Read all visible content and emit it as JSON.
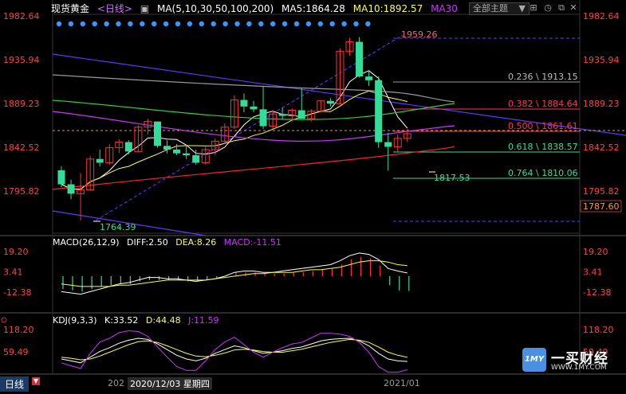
{
  "header": {
    "symbol": "现货黄金",
    "period_select": "<日线>",
    "ma_label": "MA(5,10,30,50,100,200)",
    "ma5": "MA5:1864.28",
    "ma10": "MA10:1892.57",
    "ma30": "MA30"
  },
  "toolbar": {
    "theme_select": "全部主题",
    "icons": [
      "grid-icon",
      "clock-icon",
      "restore-icon",
      "close-icon"
    ]
  },
  "colors": {
    "up": "#ff3030",
    "down": "#33dd99",
    "ma5": "#ffffff",
    "ma10": "#ffff33",
    "ma30": "#cc33ff",
    "ma50": "#33cc33",
    "ma100": "#999999",
    "ma200": "#ff2020",
    "trend": "#6633ff",
    "fib": "#ff3060"
  },
  "price_axis": {
    "left_ticks": [
      "1982.64",
      "1935.94",
      "1889.23",
      "1842.52",
      "1795.82"
    ],
    "right_ticks": [
      "1982.64",
      "1935.94",
      "1889.23",
      "1842.52",
      "1795.82"
    ],
    "current_price": "1787.60"
  },
  "annotations": {
    "high": "1959.26",
    "low1": "1764.39",
    "low2": "1817.53"
  },
  "fib_levels": [
    {
      "label": "0.236 \\ 1913.15",
      "ratio": 0.236,
      "price": 1913.15
    },
    {
      "label": "0.382 \\ 1884.64",
      "ratio": 0.382,
      "price": 1884.64
    },
    {
      "label": "0.500 \\ 1861.61",
      "ratio": 0.5,
      "price": 1861.61
    },
    {
      "label": "0.618 \\ 1838.57",
      "ratio": 0.618,
      "price": 1838.57
    },
    {
      "label": "0.764 \\ 1810.06",
      "ratio": 0.764,
      "price": 1810.06
    }
  ],
  "macd": {
    "label": "MACD(26,12,9)",
    "diff": "DIFF:2.50",
    "dea": "DEA:8.26",
    "macd": "MACD:-11.51",
    "ticks": [
      "19.20",
      "3.41",
      "-12.38"
    ]
  },
  "kdj": {
    "label": "KDJ(9,3,3)",
    "k": "K:33.52",
    "d": "D:44.48",
    "j": "J:11.59",
    "ticks": [
      "118.20",
      "59.49"
    ]
  },
  "bottom": {
    "period": "日线",
    "year_left": "202",
    "date": "2020/12/03 星期四",
    "month": "2021/01"
  },
  "watermark": {
    "logo_text": "1MY",
    "brand": "一买财经",
    "url": "WWW.1MY.COM"
  },
  "chart_data": {
    "type": "candlestick",
    "title": "现货黄金 <日线>",
    "ylim": [
      1764,
      1982.64
    ],
    "ohlc": [
      [
        1818,
        1822,
        1800,
        1803
      ],
      [
        1803,
        1808,
        1787,
        1793
      ],
      [
        1793,
        1815,
        1764.39,
        1797
      ],
      [
        1797,
        1833,
        1796,
        1830
      ],
      [
        1830,
        1840,
        1822,
        1826
      ],
      [
        1826,
        1846,
        1824,
        1842
      ],
      [
        1842,
        1851,
        1836,
        1848
      ],
      [
        1848,
        1850,
        1835,
        1838
      ],
      [
        1838,
        1866,
        1837,
        1864
      ],
      [
        1864,
        1873,
        1856,
        1870
      ],
      [
        1870,
        1870,
        1842,
        1844
      ],
      [
        1844,
        1850,
        1836,
        1840
      ],
      [
        1840,
        1846,
        1834,
        1836
      ],
      [
        1836,
        1845,
        1830,
        1834
      ],
      [
        1834,
        1840,
        1824,
        1826
      ],
      [
        1826,
        1844,
        1824,
        1840
      ],
      [
        1840,
        1852,
        1834,
        1849
      ],
      [
        1849,
        1868,
        1846,
        1864
      ],
      [
        1864,
        1898,
        1862,
        1893
      ],
      [
        1893,
        1900,
        1880,
        1886
      ],
      [
        1886,
        1892,
        1880,
        1883
      ],
      [
        1883,
        1908,
        1862,
        1865
      ],
      [
        1865,
        1882,
        1862,
        1878
      ],
      [
        1878,
        1885,
        1872,
        1876
      ],
      [
        1876,
        1884,
        1870,
        1882
      ],
      [
        1882,
        1906,
        1879,
        1873
      ],
      [
        1873,
        1883,
        1870,
        1881
      ],
      [
        1881,
        1893,
        1880,
        1892
      ],
      [
        1892,
        1895,
        1886,
        1889
      ],
      [
        1889,
        1948,
        1888,
        1945
      ],
      [
        1945,
        1959.26,
        1940,
        1955
      ],
      [
        1955,
        1960,
        1917,
        1918
      ],
      [
        1918,
        1925,
        1908,
        1914
      ],
      [
        1914,
        1918,
        1842,
        1848
      ],
      [
        1848,
        1858,
        1817.53,
        1843
      ],
      [
        1843,
        1856,
        1838,
        1852
      ],
      [
        1852,
        1862,
        1848,
        1857
      ]
    ],
    "macd_hist": [
      -10,
      -11,
      -12,
      -10,
      -8,
      -7,
      -6,
      -6,
      -4,
      -3,
      -3,
      -3,
      -3,
      -4,
      -4,
      -3,
      -2,
      0,
      3,
      3,
      3,
      2,
      2,
      2,
      3,
      3,
      4,
      5,
      6,
      9,
      13,
      15,
      14,
      8,
      -7,
      -11,
      -11.5
    ],
    "macd_diff": [
      -12,
      -13,
      -14,
      -12,
      -10,
      -8,
      -6,
      -5,
      -3,
      -1,
      -1,
      -2,
      -2,
      -3,
      -4,
      -3,
      -2,
      0,
      3,
      4,
      4,
      3,
      3,
      4,
      5,
      6,
      7,
      8,
      9,
      12,
      16,
      18,
      17,
      13,
      6,
      4,
      2.5
    ],
    "macd_dea": [
      -6,
      -7,
      -8,
      -8,
      -8,
      -8,
      -7,
      -7,
      -6,
      -5,
      -4,
      -3,
      -3,
      -3,
      -3,
      -3,
      -2,
      -1,
      0,
      1,
      2,
      2,
      3,
      3,
      3,
      4,
      5,
      5,
      6,
      7,
      9,
      11,
      12,
      12,
      11,
      9,
      8.26
    ],
    "kdj_k": [
      40,
      35,
      30,
      45,
      60,
      70,
      82,
      90,
      95,
      92,
      80,
      65,
      50,
      40,
      35,
      42,
      55,
      65,
      75,
      70,
      62,
      55,
      58,
      62,
      68,
      72,
      80,
      88,
      92,
      94,
      95,
      88,
      75,
      55,
      40,
      35,
      33.52
    ],
    "kdj_d": [
      45,
      42,
      38,
      40,
      48,
      58,
      68,
      78,
      86,
      88,
      84,
      75,
      65,
      55,
      48,
      46,
      50,
      56,
      64,
      66,
      64,
      60,
      58,
      58,
      62,
      66,
      72,
      78,
      84,
      88,
      92,
      90,
      84,
      72,
      58,
      50,
      44.48
    ],
    "kdj_j": [
      30,
      22,
      15,
      55,
      85,
      95,
      110,
      115,
      113,
      100,
      72,
      45,
      20,
      10,
      10,
      35,
      65,
      85,
      98,
      78,
      58,
      45,
      58,
      70,
      80,
      84,
      96,
      108,
      108,
      106,
      100,
      84,
      58,
      20,
      5,
      5,
      11.59
    ]
  }
}
